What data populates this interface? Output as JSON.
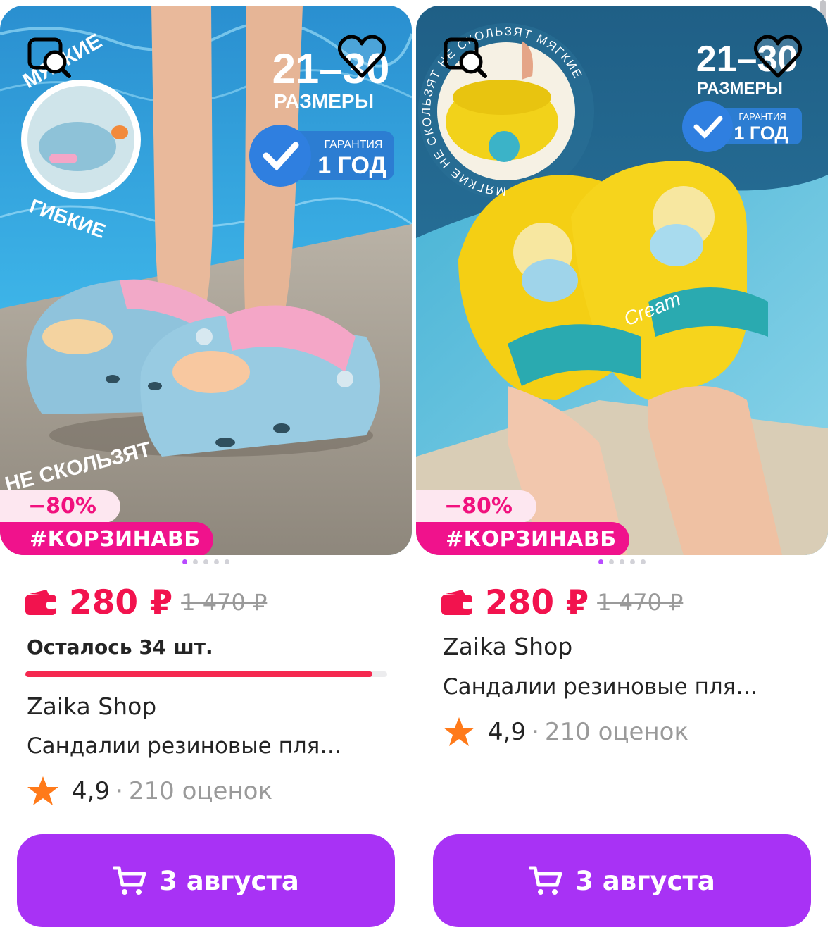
{
  "colors": {
    "price": "#f2134e",
    "discount_bg": "#fde7f0",
    "tag_bg": "#f0128c",
    "button": "#a832f5",
    "star": "#ff7a1a",
    "stock_bar": "#f5284f"
  },
  "products": [
    {
      "image_texts": {
        "top_arc": "МЯГКИЕ",
        "bottom_arc": "ГИБКИЕ",
        "sizes_number": "21–30",
        "sizes_label": "РАЗМЕРЫ",
        "guarantee_small": "ГАРАНТИЯ",
        "guarantee_big": "1 ГОД",
        "nonslip": "НЕ СКОЛЬЗЯТ"
      },
      "discount": "−80%",
      "tag": "#КОРЗИНАВБ",
      "price_now": "280 ₽",
      "price_old": "1 470 ₽",
      "stock_text": "Осталось 34 шт.",
      "stock_level": 0.96,
      "brand": "Zaika Shop",
      "title": "Сандалии резиновые пля…",
      "rating": "4,9",
      "rating_sep": "·",
      "reviews": "210 оценок",
      "button_label": "3 августа",
      "icons": [
        "search-similar-icon",
        "heart-icon",
        "wallet-icon",
        "star-icon",
        "cart-icon"
      ]
    },
    {
      "image_texts": {
        "ring_text": "МЯГКИЕ НЕ СКОЛЬЗЯТ НЕ СКОЛЬЗЯТ МЯГКИЕ",
        "sizes_number": "21–30",
        "sizes_label": "РАЗМЕРЫ",
        "guarantee_small": "ГАРАНТИЯ",
        "guarantee_big": "1 ГОД",
        "shoe_print": "Cream"
      },
      "discount": "−80%",
      "tag": "#КОРЗИНАВБ",
      "price_now": "280 ₽",
      "price_old": "1 470 ₽",
      "brand": "Zaika Shop",
      "title": "Сандалии резиновые пля…",
      "rating": "4,9",
      "rating_sep": "·",
      "reviews": "210 оценок",
      "button_label": "3 августа",
      "icons": [
        "search-similar-icon",
        "heart-icon",
        "wallet-icon",
        "star-icon",
        "cart-icon"
      ]
    }
  ]
}
